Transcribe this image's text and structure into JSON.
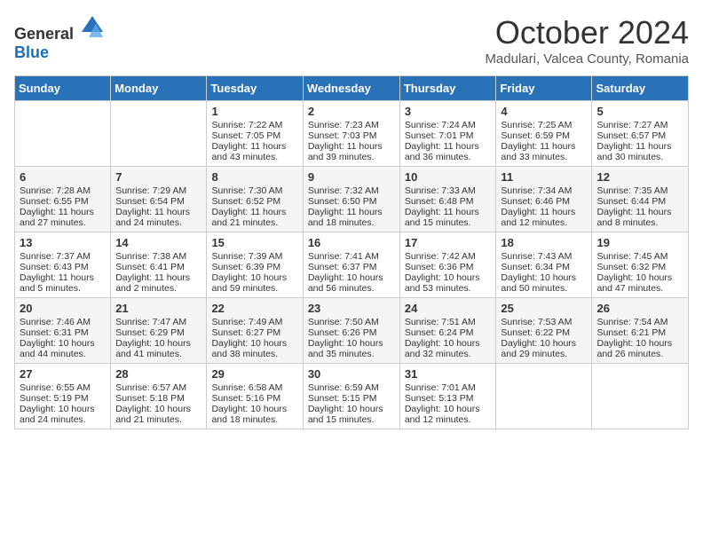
{
  "header": {
    "logo_general": "General",
    "logo_blue": "Blue",
    "month_title": "October 2024",
    "location": "Madulari, Valcea County, Romania"
  },
  "weekdays": [
    "Sunday",
    "Monday",
    "Tuesday",
    "Wednesday",
    "Thursday",
    "Friday",
    "Saturday"
  ],
  "weeks": [
    [
      {
        "day": "",
        "info": ""
      },
      {
        "day": "",
        "info": ""
      },
      {
        "day": "1",
        "info": "Sunrise: 7:22 AM\nSunset: 7:05 PM\nDaylight: 11 hours and 43 minutes."
      },
      {
        "day": "2",
        "info": "Sunrise: 7:23 AM\nSunset: 7:03 PM\nDaylight: 11 hours and 39 minutes."
      },
      {
        "day": "3",
        "info": "Sunrise: 7:24 AM\nSunset: 7:01 PM\nDaylight: 11 hours and 36 minutes."
      },
      {
        "day": "4",
        "info": "Sunrise: 7:25 AM\nSunset: 6:59 PM\nDaylight: 11 hours and 33 minutes."
      },
      {
        "day": "5",
        "info": "Sunrise: 7:27 AM\nSunset: 6:57 PM\nDaylight: 11 hours and 30 minutes."
      }
    ],
    [
      {
        "day": "6",
        "info": "Sunrise: 7:28 AM\nSunset: 6:55 PM\nDaylight: 11 hours and 27 minutes."
      },
      {
        "day": "7",
        "info": "Sunrise: 7:29 AM\nSunset: 6:54 PM\nDaylight: 11 hours and 24 minutes."
      },
      {
        "day": "8",
        "info": "Sunrise: 7:30 AM\nSunset: 6:52 PM\nDaylight: 11 hours and 21 minutes."
      },
      {
        "day": "9",
        "info": "Sunrise: 7:32 AM\nSunset: 6:50 PM\nDaylight: 11 hours and 18 minutes."
      },
      {
        "day": "10",
        "info": "Sunrise: 7:33 AM\nSunset: 6:48 PM\nDaylight: 11 hours and 15 minutes."
      },
      {
        "day": "11",
        "info": "Sunrise: 7:34 AM\nSunset: 6:46 PM\nDaylight: 11 hours and 12 minutes."
      },
      {
        "day": "12",
        "info": "Sunrise: 7:35 AM\nSunset: 6:44 PM\nDaylight: 11 hours and 8 minutes."
      }
    ],
    [
      {
        "day": "13",
        "info": "Sunrise: 7:37 AM\nSunset: 6:43 PM\nDaylight: 11 hours and 5 minutes."
      },
      {
        "day": "14",
        "info": "Sunrise: 7:38 AM\nSunset: 6:41 PM\nDaylight: 11 hours and 2 minutes."
      },
      {
        "day": "15",
        "info": "Sunrise: 7:39 AM\nSunset: 6:39 PM\nDaylight: 10 hours and 59 minutes."
      },
      {
        "day": "16",
        "info": "Sunrise: 7:41 AM\nSunset: 6:37 PM\nDaylight: 10 hours and 56 minutes."
      },
      {
        "day": "17",
        "info": "Sunrise: 7:42 AM\nSunset: 6:36 PM\nDaylight: 10 hours and 53 minutes."
      },
      {
        "day": "18",
        "info": "Sunrise: 7:43 AM\nSunset: 6:34 PM\nDaylight: 10 hours and 50 minutes."
      },
      {
        "day": "19",
        "info": "Sunrise: 7:45 AM\nSunset: 6:32 PM\nDaylight: 10 hours and 47 minutes."
      }
    ],
    [
      {
        "day": "20",
        "info": "Sunrise: 7:46 AM\nSunset: 6:31 PM\nDaylight: 10 hours and 44 minutes."
      },
      {
        "day": "21",
        "info": "Sunrise: 7:47 AM\nSunset: 6:29 PM\nDaylight: 10 hours and 41 minutes."
      },
      {
        "day": "22",
        "info": "Sunrise: 7:49 AM\nSunset: 6:27 PM\nDaylight: 10 hours and 38 minutes."
      },
      {
        "day": "23",
        "info": "Sunrise: 7:50 AM\nSunset: 6:26 PM\nDaylight: 10 hours and 35 minutes."
      },
      {
        "day": "24",
        "info": "Sunrise: 7:51 AM\nSunset: 6:24 PM\nDaylight: 10 hours and 32 minutes."
      },
      {
        "day": "25",
        "info": "Sunrise: 7:53 AM\nSunset: 6:22 PM\nDaylight: 10 hours and 29 minutes."
      },
      {
        "day": "26",
        "info": "Sunrise: 7:54 AM\nSunset: 6:21 PM\nDaylight: 10 hours and 26 minutes."
      }
    ],
    [
      {
        "day": "27",
        "info": "Sunrise: 6:55 AM\nSunset: 5:19 PM\nDaylight: 10 hours and 24 minutes."
      },
      {
        "day": "28",
        "info": "Sunrise: 6:57 AM\nSunset: 5:18 PM\nDaylight: 10 hours and 21 minutes."
      },
      {
        "day": "29",
        "info": "Sunrise: 6:58 AM\nSunset: 5:16 PM\nDaylight: 10 hours and 18 minutes."
      },
      {
        "day": "30",
        "info": "Sunrise: 6:59 AM\nSunset: 5:15 PM\nDaylight: 10 hours and 15 minutes."
      },
      {
        "day": "31",
        "info": "Sunrise: 7:01 AM\nSunset: 5:13 PM\nDaylight: 10 hours and 12 minutes."
      },
      {
        "day": "",
        "info": ""
      },
      {
        "day": "",
        "info": ""
      }
    ]
  ]
}
